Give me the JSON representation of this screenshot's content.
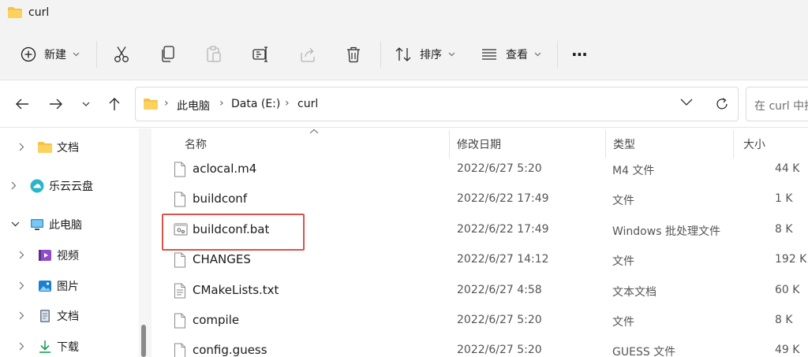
{
  "window": {
    "title": "curl"
  },
  "toolbar": {
    "new_label": "新建",
    "sort_label": "排序",
    "view_label": "查看",
    "more_label": "···"
  },
  "address": {
    "crumbs": [
      "此电脑",
      "Data (E:)",
      "curl"
    ],
    "search_placeholder": "在 curl 中搜"
  },
  "sidebar": {
    "items": [
      {
        "label": "文档",
        "icon": "folder-icon"
      },
      {
        "label": "乐云云盘",
        "icon": "cloud-drive-icon"
      },
      {
        "label": "此电脑",
        "icon": "this-pc-icon"
      },
      {
        "label": "视频",
        "icon": "videos-icon"
      },
      {
        "label": "图片",
        "icon": "pictures-icon"
      },
      {
        "label": "文档",
        "icon": "documents-icon"
      },
      {
        "label": "下载",
        "icon": "downloads-icon"
      }
    ]
  },
  "table": {
    "columns": [
      "名称",
      "修改日期",
      "类型",
      "大小"
    ],
    "rows": [
      {
        "name": "aclocal.m4",
        "date": "2022/6/27 5:20",
        "type": "M4 文件",
        "size": "44 K",
        "icon": "file-icon"
      },
      {
        "name": "buildconf",
        "date": "2022/6/22 17:49",
        "type": "文件",
        "size": "1 K",
        "icon": "file-icon"
      },
      {
        "name": "buildconf.bat",
        "date": "2022/6/22 17:49",
        "type": "Windows 批处理文件",
        "size": "8 K",
        "icon": "batch-file-icon"
      },
      {
        "name": "CHANGES",
        "date": "2022/6/27 14:12",
        "type": "文件",
        "size": "192 K",
        "icon": "file-icon"
      },
      {
        "name": "CMakeLists.txt",
        "date": "2022/6/27 4:58",
        "type": "文本文档",
        "size": "60 K",
        "icon": "text-file-icon"
      },
      {
        "name": "compile",
        "date": "2022/6/27 5:20",
        "type": "文件",
        "size": "8 K",
        "icon": "file-icon"
      },
      {
        "name": "config.guess",
        "date": "2022/6/27 5:20",
        "type": "GUESS 文件",
        "size": "49 K",
        "icon": "file-icon"
      }
    ]
  },
  "colors": {
    "accent": "#005fb8",
    "folder": "#f4c244",
    "highlight": "#d9534f"
  }
}
